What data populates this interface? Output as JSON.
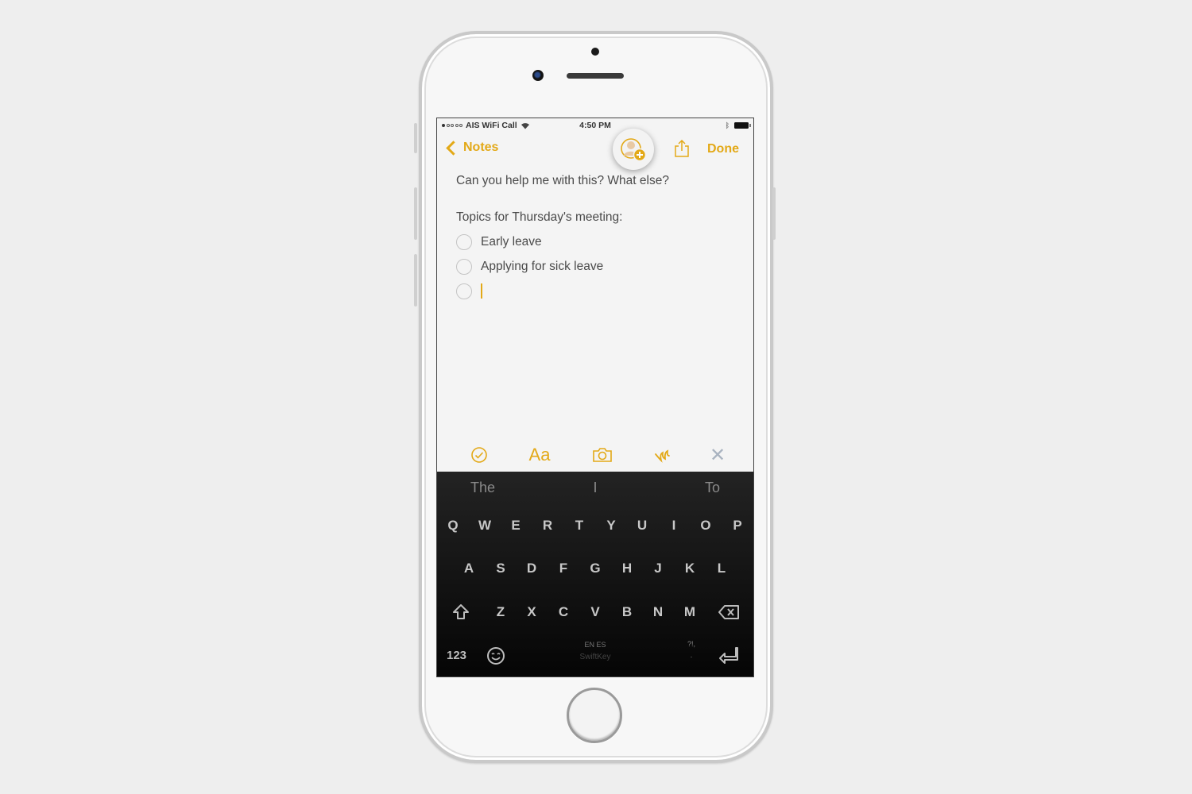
{
  "status_bar": {
    "carrier": "AIS WiFi Call",
    "signal_bars_filled": 1,
    "signal_bars_total": 5,
    "time": "4:50 PM",
    "bluetooth": "bluetooth-icon",
    "battery": "battery-icon"
  },
  "navbar": {
    "back_label": "Notes",
    "done_label": "Done",
    "collaborate_icon": "add-person-icon",
    "share_icon": "share-icon"
  },
  "note": {
    "line1": "Can you help me with this? What else?",
    "heading": "Topics for Thursday's meeting:",
    "checklist": [
      {
        "text": "Early leave",
        "checked": false
      },
      {
        "text": "Applying for sick leave",
        "checked": false
      },
      {
        "text": "",
        "checked": false
      }
    ]
  },
  "toolbar": {
    "items": [
      "checklist-icon",
      "format-text-icon",
      "camera-icon",
      "sketch-icon",
      "close-icon"
    ],
    "format_label": "Aa",
    "close_label": "✕"
  },
  "keyboard": {
    "predictions": [
      "The",
      "I",
      "To"
    ],
    "row1": [
      "Q",
      "W",
      "E",
      "R",
      "T",
      "Y",
      "U",
      "I",
      "O",
      "P"
    ],
    "row2": [
      "A",
      "S",
      "D",
      "F",
      "G",
      "H",
      "J",
      "K",
      "L"
    ],
    "row3": [
      "Z",
      "X",
      "C",
      "V",
      "B",
      "N",
      "M"
    ],
    "numbers_label": "123",
    "language_label": "EN ES",
    "brand_label": "SwiftKey",
    "punct_top": "?!,",
    "punct_bottom": "."
  },
  "colors": {
    "accent": "#e3a917",
    "keyboard_bg": "#1a1a1a",
    "note_text": "#4a4a4a",
    "screen_bg": "#f4f4f4"
  }
}
